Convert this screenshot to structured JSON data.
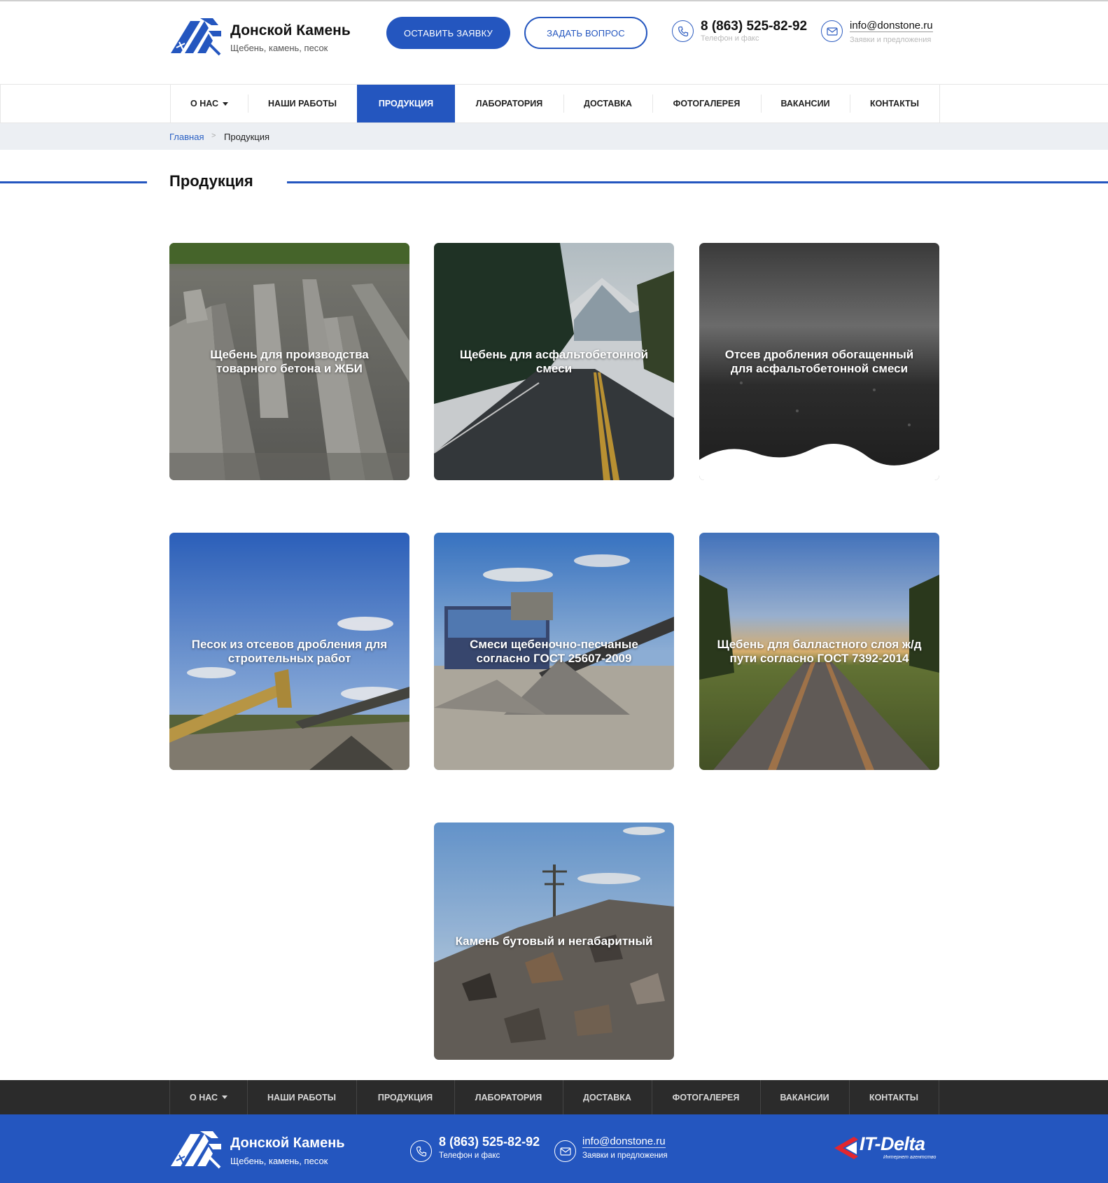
{
  "header": {
    "brand_name": "Донской Камень",
    "brand_tagline": "Щебень, камень, песок",
    "cta_request": "ОСТАВИТЬ ЗАЯВКУ",
    "cta_question": "ЗАДАТЬ ВОПРОС",
    "phone": "8 (863) 525-82-92",
    "phone_caption": "Телефон и факс",
    "email": "info@donstone.ru",
    "email_caption": "Заявки и предложения"
  },
  "nav": {
    "items": [
      {
        "label": "О НАС",
        "has_dropdown": true
      },
      {
        "label": "НАШИ РАБОТЫ"
      },
      {
        "label": "ПРОДУКЦИЯ",
        "active": true
      },
      {
        "label": "ЛАБОРАТОРИЯ"
      },
      {
        "label": "ДОСТАВКА"
      },
      {
        "label": "ФОТОГАЛЕРЕЯ"
      },
      {
        "label": "ВАКАНСИИ"
      },
      {
        "label": "КОНТАКТЫ"
      }
    ]
  },
  "breadcrumb": {
    "home": "Главная",
    "separator": ">",
    "current": "Продукция"
  },
  "page": {
    "title": "Продукция"
  },
  "products": [
    {
      "title": "Щебень для производства товарного бетона и ЖБИ",
      "image": "concrete-blocks-photo"
    },
    {
      "title": "Щебень для асфальтобетонной смеси",
      "image": "mountain-road-photo"
    },
    {
      "title": "Отсев дробления обогащенный для асфальтобетонной смеси",
      "image": "asphalt-screenings-photo"
    },
    {
      "title": "Песок из отсевов дробления для строительных работ",
      "image": "conveyor-sand-photo"
    },
    {
      "title": "Смеси щебеночно-песчаные согласно ГОСТ 25607-2009",
      "image": "crushing-plant-photo"
    },
    {
      "title": "Щебень для балластного слоя ж/д пути согласно ГОСТ 7392-2014",
      "image": "railway-track-photo"
    },
    {
      "title": "Камень бутовый и негабаритный",
      "image": "rubble-stone-photo"
    }
  ],
  "footer": {
    "brand_name": "Донской Камень",
    "brand_tagline": "Щебень, камень, песок",
    "phone": "8 (863) 525-82-92",
    "phone_caption": "Телефон и факс",
    "email": "info@donstone.ru",
    "email_caption": "Заявки и предложения",
    "developer_name": "IT-Delta",
    "developer_caption": "Интернет агентство"
  },
  "colors": {
    "accent": "#2456bf",
    "footer_nav_bg": "#2b2b2b",
    "breadcrumb_bg": "#eceff3"
  }
}
